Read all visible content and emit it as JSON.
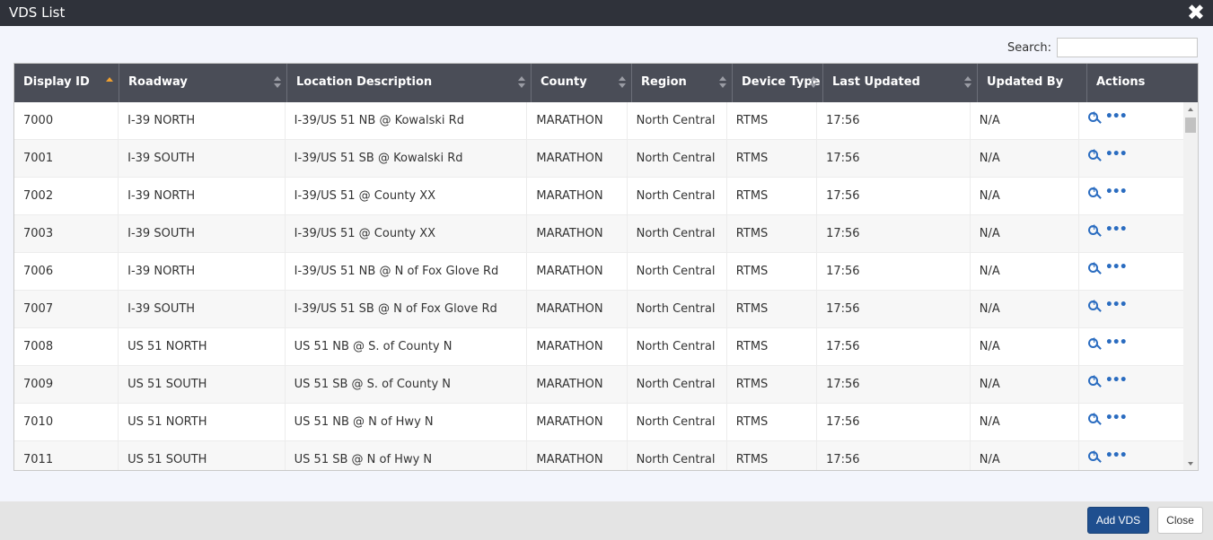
{
  "window": {
    "title": "VDS List",
    "close_glyph": "✖"
  },
  "search": {
    "label": "Search:",
    "value": "",
    "placeholder": ""
  },
  "table": {
    "columns": [
      {
        "label": "Display ID",
        "sort": "asc"
      },
      {
        "label": "Roadway",
        "sort": "both"
      },
      {
        "label": "Location Description",
        "sort": "both"
      },
      {
        "label": "County",
        "sort": "both"
      },
      {
        "label": "Region",
        "sort": "both"
      },
      {
        "label": "Device Type",
        "sort": "both"
      },
      {
        "label": "Last Updated",
        "sort": "both"
      },
      {
        "label": "Updated By",
        "sort": "none"
      },
      {
        "label": "Actions",
        "sort": "none"
      }
    ],
    "rows": [
      {
        "id": "7000",
        "roadway": "I-39 NORTH",
        "location": "I-39/US 51 NB @ Kowalski Rd",
        "county": "MARATHON",
        "region": "North Central",
        "device": "RTMS",
        "updated": "17:56",
        "by": "N/A"
      },
      {
        "id": "7001",
        "roadway": "I-39 SOUTH",
        "location": "I-39/US 51 SB @ Kowalski Rd",
        "county": "MARATHON",
        "region": "North Central",
        "device": "RTMS",
        "updated": "17:56",
        "by": "N/A"
      },
      {
        "id": "7002",
        "roadway": "I-39 NORTH",
        "location": "I-39/US 51 @ County XX",
        "county": "MARATHON",
        "region": "North Central",
        "device": "RTMS",
        "updated": "17:56",
        "by": "N/A"
      },
      {
        "id": "7003",
        "roadway": "I-39 SOUTH",
        "location": "I-39/US 51 @ County XX",
        "county": "MARATHON",
        "region": "North Central",
        "device": "RTMS",
        "updated": "17:56",
        "by": "N/A"
      },
      {
        "id": "7006",
        "roadway": "I-39 NORTH",
        "location": "I-39/US 51 NB @ N of Fox Glove Rd",
        "county": "MARATHON",
        "region": "North Central",
        "device": "RTMS",
        "updated": "17:56",
        "by": "N/A"
      },
      {
        "id": "7007",
        "roadway": "I-39 SOUTH",
        "location": "I-39/US 51 SB @ N of Fox Glove Rd",
        "county": "MARATHON",
        "region": "North Central",
        "device": "RTMS",
        "updated": "17:56",
        "by": "N/A"
      },
      {
        "id": "7008",
        "roadway": "US 51 NORTH",
        "location": "US 51 NB @ S. of County N",
        "county": "MARATHON",
        "region": "North Central",
        "device": "RTMS",
        "updated": "17:56",
        "by": "N/A"
      },
      {
        "id": "7009",
        "roadway": "US 51 SOUTH",
        "location": "US 51 SB @ S. of County N",
        "county": "MARATHON",
        "region": "North Central",
        "device": "RTMS",
        "updated": "17:56",
        "by": "N/A"
      },
      {
        "id": "7010",
        "roadway": "US 51 NORTH",
        "location": "US 51 NB @ N of Hwy N",
        "county": "MARATHON",
        "region": "North Central",
        "device": "RTMS",
        "updated": "17:56",
        "by": "N/A"
      },
      {
        "id": "7011",
        "roadway": "US 51 SOUTH",
        "location": "US 51 SB @ N of Hwy N",
        "county": "MARATHON",
        "region": "North Central",
        "device": "RTMS",
        "updated": "17:56",
        "by": "N/A"
      }
    ],
    "row_action_icons": [
      "zoom-in-icon",
      "more-icon"
    ]
  },
  "footer": {
    "add_label": "Add VDS",
    "close_label": "Close"
  },
  "colors": {
    "header_bg": "#4a4d57",
    "titlebar_bg": "#2f323a",
    "accent": "#2a6cc0",
    "primary_button": "#1f4f8f",
    "sort_active": "#f0a030"
  }
}
